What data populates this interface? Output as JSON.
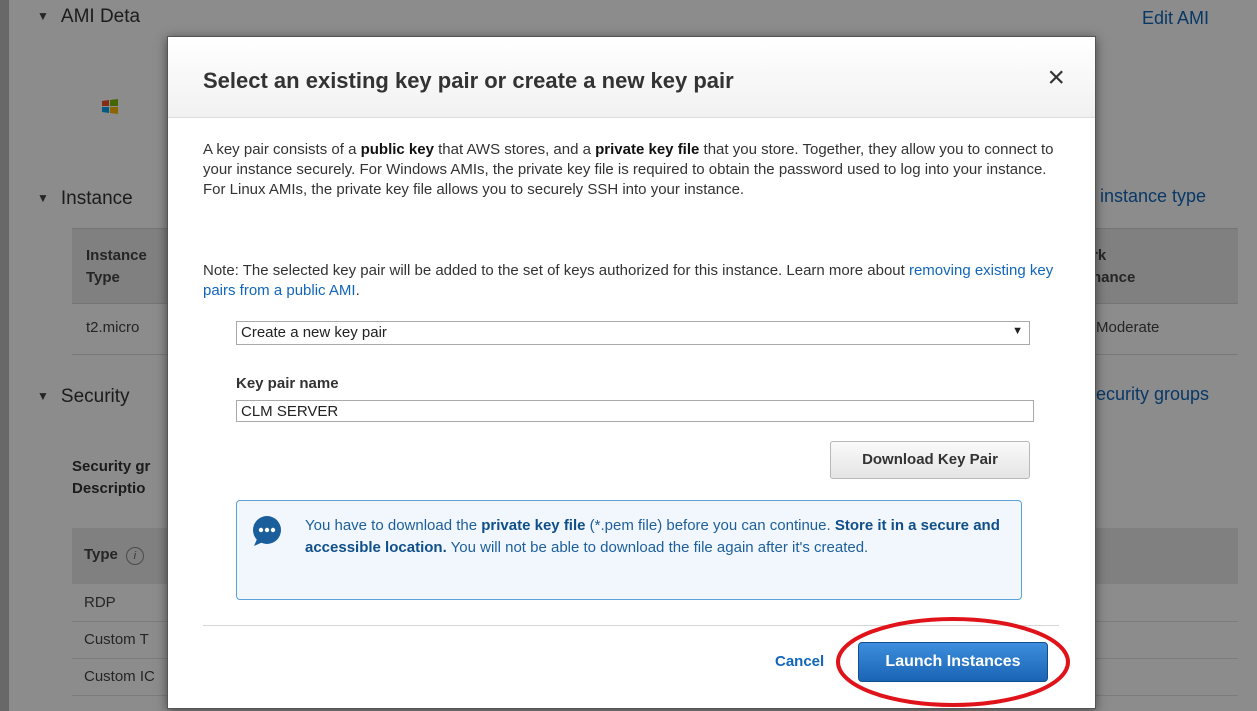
{
  "background": {
    "sections": {
      "ami": "AMI Deta",
      "instance": "Instance",
      "security": "Security"
    },
    "links": {
      "edit_ami": "Edit AMI",
      "instance_type": "instance type",
      "security_groups": "ecurity groups"
    },
    "instance_table": {
      "col1_line1": "Instance",
      "col1_line2": "Type",
      "col_right_line1": "rk",
      "col_right_line2": "nance",
      "row_type": "t2.micro",
      "row_network": "Moderate"
    },
    "security_labels": {
      "line1": "Security gr",
      "line2": "Descriptio"
    },
    "rules_table": {
      "type_header": "Type",
      "info_glyph": "i",
      "rows": [
        "RDP",
        "Custom T",
        "Custom IC"
      ]
    }
  },
  "modal": {
    "title": "Select an existing key pair or create a new key pair",
    "close_glyph": "×",
    "intro": {
      "t1": "A key pair consists of a ",
      "b1": "public key",
      "t2": " that AWS stores, and a ",
      "b2": "private key file",
      "t3": " that you store. Together, they allow you to connect to your instance securely. For Windows AMIs, the private key file is required to obtain the password used to log into your instance. For Linux AMIs, the private key file allows you to securely SSH into your instance."
    },
    "note": {
      "text": "Note: The selected key pair will be added to the set of keys authorized for this instance. Learn more about ",
      "link": "removing existing key pairs from a public AMI",
      "end": "."
    },
    "key_pair_select": {
      "selected": "Create a new key pair",
      "arrow_glyph": "▼"
    },
    "key_pair_name": {
      "label": "Key pair name",
      "value": "CLM SERVER"
    },
    "download_button": "Download Key Pair",
    "info_box": {
      "t1": "You have to download the ",
      "b1": "private key file",
      "t2": " (*.pem file) before you can continue. ",
      "b2": "Store it in a secure and accessible location.",
      "t3": " You will not be able to download the file again after it's created."
    },
    "cancel": "Cancel",
    "launch_button": "Launch Instances"
  },
  "colors": {
    "link": "#1166bb",
    "primary_button": "#1a64b4",
    "highlight_ring": "#e0121a",
    "info_box_border": "#5ea1d8"
  }
}
